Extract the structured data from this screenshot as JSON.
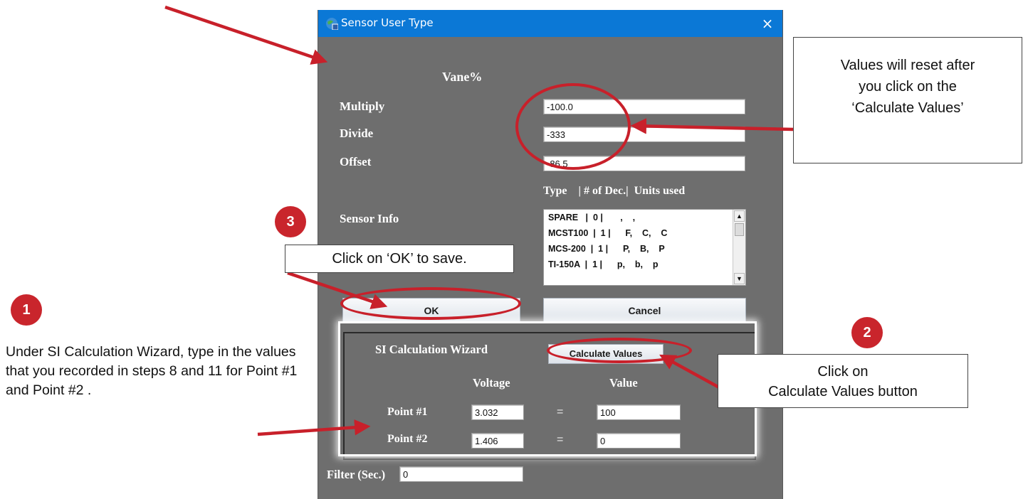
{
  "dialog": {
    "title": "Sensor User Type",
    "close_glyph": "×",
    "sensor_name": "Vane%",
    "multiply_label": "Multiply",
    "multiply_value": "-100.0",
    "divide_label": "Divide",
    "divide_value": "-333",
    "offset_label": "Offset",
    "offset_value": "-86.5",
    "columns_header": "Type    | # of Dec.|  Units used",
    "sensor_info_label": "Sensor Info",
    "sensor_rows": [
      "SPARE   |  0 |       ,    ,",
      "MCST100  |  1 |      F,    C,    C",
      "MCS-200  |  1 |      P,    B,    P",
      "TI-150A  |  1 |      p,    b,    p"
    ],
    "ok_label": "OK",
    "cancel_label": "Cancel",
    "wizard": {
      "title": "SI Calculation Wizard",
      "calculate_label": "Calculate Values",
      "voltage_header": "Voltage",
      "value_header": "Value",
      "point1_label": "Point #1",
      "point1_voltage": "3.032",
      "point1_value": "100",
      "point2_label": "Point #2",
      "point2_voltage": "1.406",
      "point2_value": "0",
      "equals": "="
    },
    "filter_label": "Filter (Sec.)",
    "filter_value": "0"
  },
  "annotations": {
    "badge1": "1",
    "badge2": "2",
    "badge3": "3",
    "step1_text": "Under SI Calculation Wizard, type in the values that you recorded in steps 8 and 11 for Point #1 and Point #2 .",
    "step2_line1": "Click on",
    "step2_line2": "Calculate Values button",
    "step3_text": "Click on ‘OK’ to save.",
    "reset_line1": "Values will reset after",
    "reset_line2": "you click on the",
    "reset_line3": "‘Calculate Values’"
  },
  "colors": {
    "titlebar": "#0b78d6",
    "dialog_bg": "#6e6e6e",
    "annotation_red": "#c8202a"
  },
  "icons": {
    "app": "globe-app-icon",
    "close": "close-icon"
  }
}
